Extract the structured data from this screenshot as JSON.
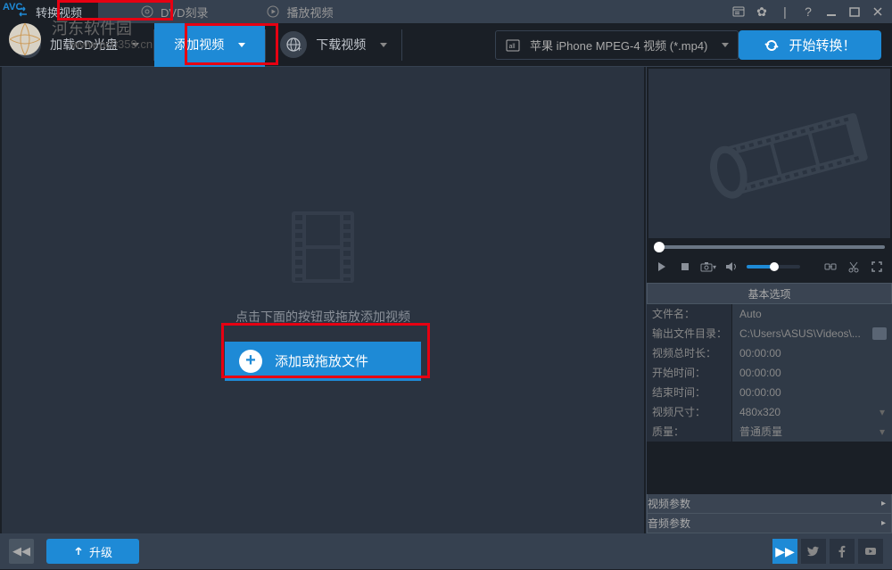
{
  "tabs": {
    "convert": "转换视频",
    "dvd": "DVD刻录",
    "play": "播放视频"
  },
  "toolbar": {
    "load_cd": "加载CD光盘",
    "add_video": "添加视频",
    "download_video": "下载视频"
  },
  "profile": {
    "text": "苹果 iPhone MPEG-4 视频 (*.mp4)"
  },
  "start_convert": "开始转换！",
  "drop": {
    "hint": "点击下面的按钮或拖放添加视频",
    "add_btn": "添加或拖放文件"
  },
  "panel": {
    "basic_options": "基本选项",
    "filename_label": "文件名：",
    "filename_value": "Auto",
    "output_dir_label": "输出文件目录：",
    "output_dir_value": "C:\\Users\\ASUS\\Videos\\...",
    "total_duration_label": "视频总时长：",
    "total_duration_value": "00:00:00",
    "start_time_label": "开始时间：",
    "start_time_value": "00:00:00",
    "end_time_label": "结束时间：",
    "end_time_value": "00:00:00",
    "video_size_label": "视频尺寸：",
    "video_size_value": "480x320",
    "quality_label": "质量：",
    "quality_value": "普通质量",
    "video_params": "视频参数",
    "audio_params": "音频参数"
  },
  "footer": {
    "upgrade": "升级"
  },
  "watermark": {
    "title": "河东软件园",
    "url": "www.pc0359.cn"
  },
  "logo": "AVC"
}
